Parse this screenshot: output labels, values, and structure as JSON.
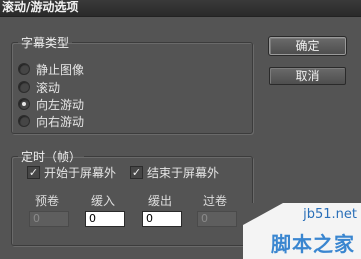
{
  "window": {
    "title": "滚动/游动选项"
  },
  "subtitle_group": {
    "legend": "字幕类型",
    "options": [
      {
        "label": "静止图像",
        "checked": false
      },
      {
        "label": "滚动",
        "checked": false
      },
      {
        "label": "向左游动",
        "checked": true
      },
      {
        "label": "向右游动",
        "checked": false
      }
    ]
  },
  "timing_group": {
    "legend": "定时（帧）",
    "start_offscreen": {
      "label": "开始于屏幕外",
      "checked": true
    },
    "end_offscreen": {
      "label": "结束于屏幕外",
      "checked": true
    },
    "fields": [
      {
        "label": "预卷",
        "value": "0",
        "enabled": false
      },
      {
        "label": "缓入",
        "value": "0",
        "enabled": true
      },
      {
        "label": "缓出",
        "value": "0",
        "enabled": true
      },
      {
        "label": "过卷",
        "value": "0",
        "enabled": false
      }
    ]
  },
  "buttons": {
    "ok": "确定",
    "cancel": "取消"
  },
  "watermark": {
    "site": "jb51.net",
    "name": "脚本之家"
  }
}
